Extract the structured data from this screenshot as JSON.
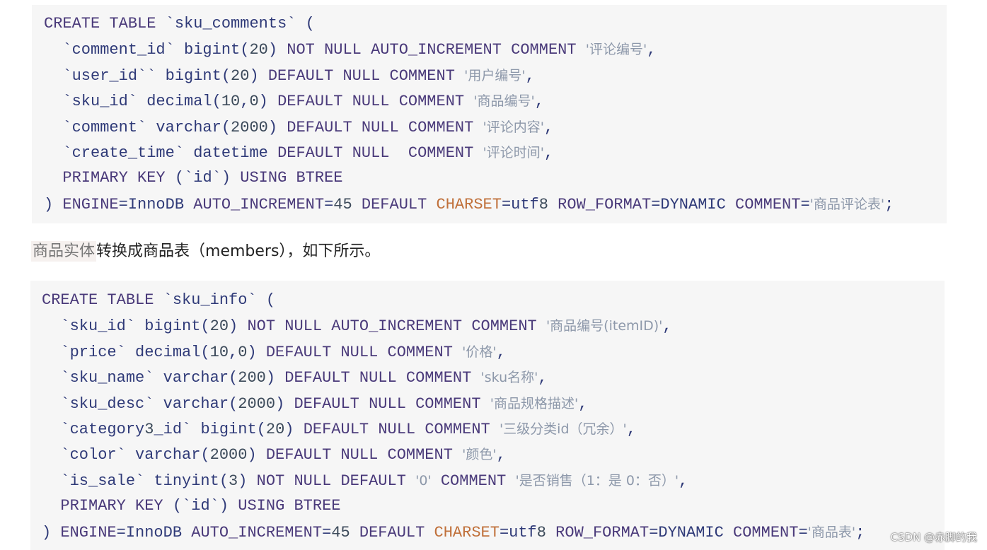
{
  "block1": {
    "lines": [
      "CREATE TABLE `sku_comments` (",
      "  `comment_id` bigint(20) NOT NULL AUTO_INCREMENT COMMENT '评论编号',",
      "  `user_id`` bigint(20) DEFAULT NULL COMMENT '用户编号',",
      "  `sku_id` decimal(10,0) DEFAULT NULL COMMENT '商品编号',",
      "  `comment` varchar(2000) DEFAULT NULL COMMENT '评论内容',",
      "  `create_time` datetime DEFAULT NULL  COMMENT '评论时间',",
      "  PRIMARY KEY (`id`) USING BTREE",
      ") ENGINE=InnoDB AUTO_INCREMENT=45 DEFAULT CHARSET=utf8 ROW_FORMAT=DYNAMIC COMMENT='商品评论表';"
    ]
  },
  "paragraph": {
    "highlight": "商品实体",
    "text": "转换成商品表（members），如下所示。"
  },
  "block2": {
    "lines": [
      "CREATE TABLE `sku_info` (",
      "  `sku_id` bigint(20) NOT NULL AUTO_INCREMENT COMMENT '商品编号(itemID)',",
      "  `price` decimal(10,0) DEFAULT NULL COMMENT '价格',",
      "  `sku_name` varchar(200) DEFAULT NULL COMMENT 'sku名称',",
      "  `sku_desc` varchar(2000) DEFAULT NULL COMMENT '商品规格描述',",
      "  `category3_id` bigint(20) DEFAULT NULL COMMENT '三级分类id（冗余）',",
      "  `color` varchar(2000) DEFAULT NULL COMMENT '颜色',",
      "  `is_sale` tinyint(3) NOT NULL DEFAULT '0' COMMENT '是否销售（1：是 0：否）',",
      "  PRIMARY KEY (`id`) USING BTREE",
      ") ENGINE=InnoDB AUTO_INCREMENT=45 DEFAULT CHARSET=utf8 ROW_FORMAT=DYNAMIC COMMENT='商品表';"
    ]
  },
  "watermark": "CSDN @赤脚的我",
  "colors": {
    "keyword": "#4a3a7a",
    "identifier": "#2f3a78",
    "string": "#8d98aa",
    "charset": "#c0703a",
    "code_bg": "#f6f6f6"
  }
}
